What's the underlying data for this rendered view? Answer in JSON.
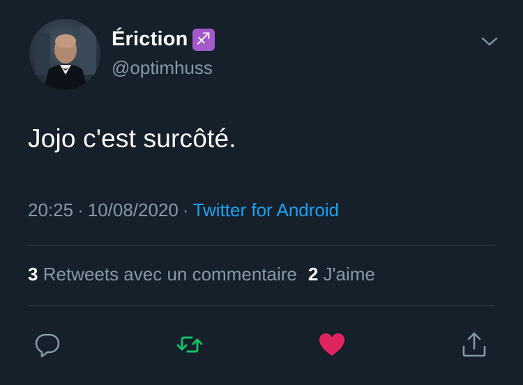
{
  "user": {
    "display_name": "Ériction",
    "emoji": "♐",
    "handle": "@optimhuss"
  },
  "tweet": {
    "text": "Jojo c'est surcôté.",
    "time": "20:25",
    "date": "10/08/2020",
    "separator": "·",
    "source": "Twitter for Android"
  },
  "stats": {
    "retweets_count": "3",
    "retweets_label": "Retweets avec un commentaire",
    "likes_count": "2",
    "likes_label": "J'aime"
  },
  "actions": {
    "reply_icon": "reply-icon",
    "retweet_icon": "retweet-icon",
    "like_icon": "heart-icon",
    "share_icon": "share-icon"
  },
  "colors": {
    "background": "#15202b",
    "secondary_text": "#8899a6",
    "link": "#1da1f2",
    "retweet": "#17bf63",
    "like": "#e0245e",
    "divider": "#38444d",
    "emoji_badge": "#a259c9"
  }
}
